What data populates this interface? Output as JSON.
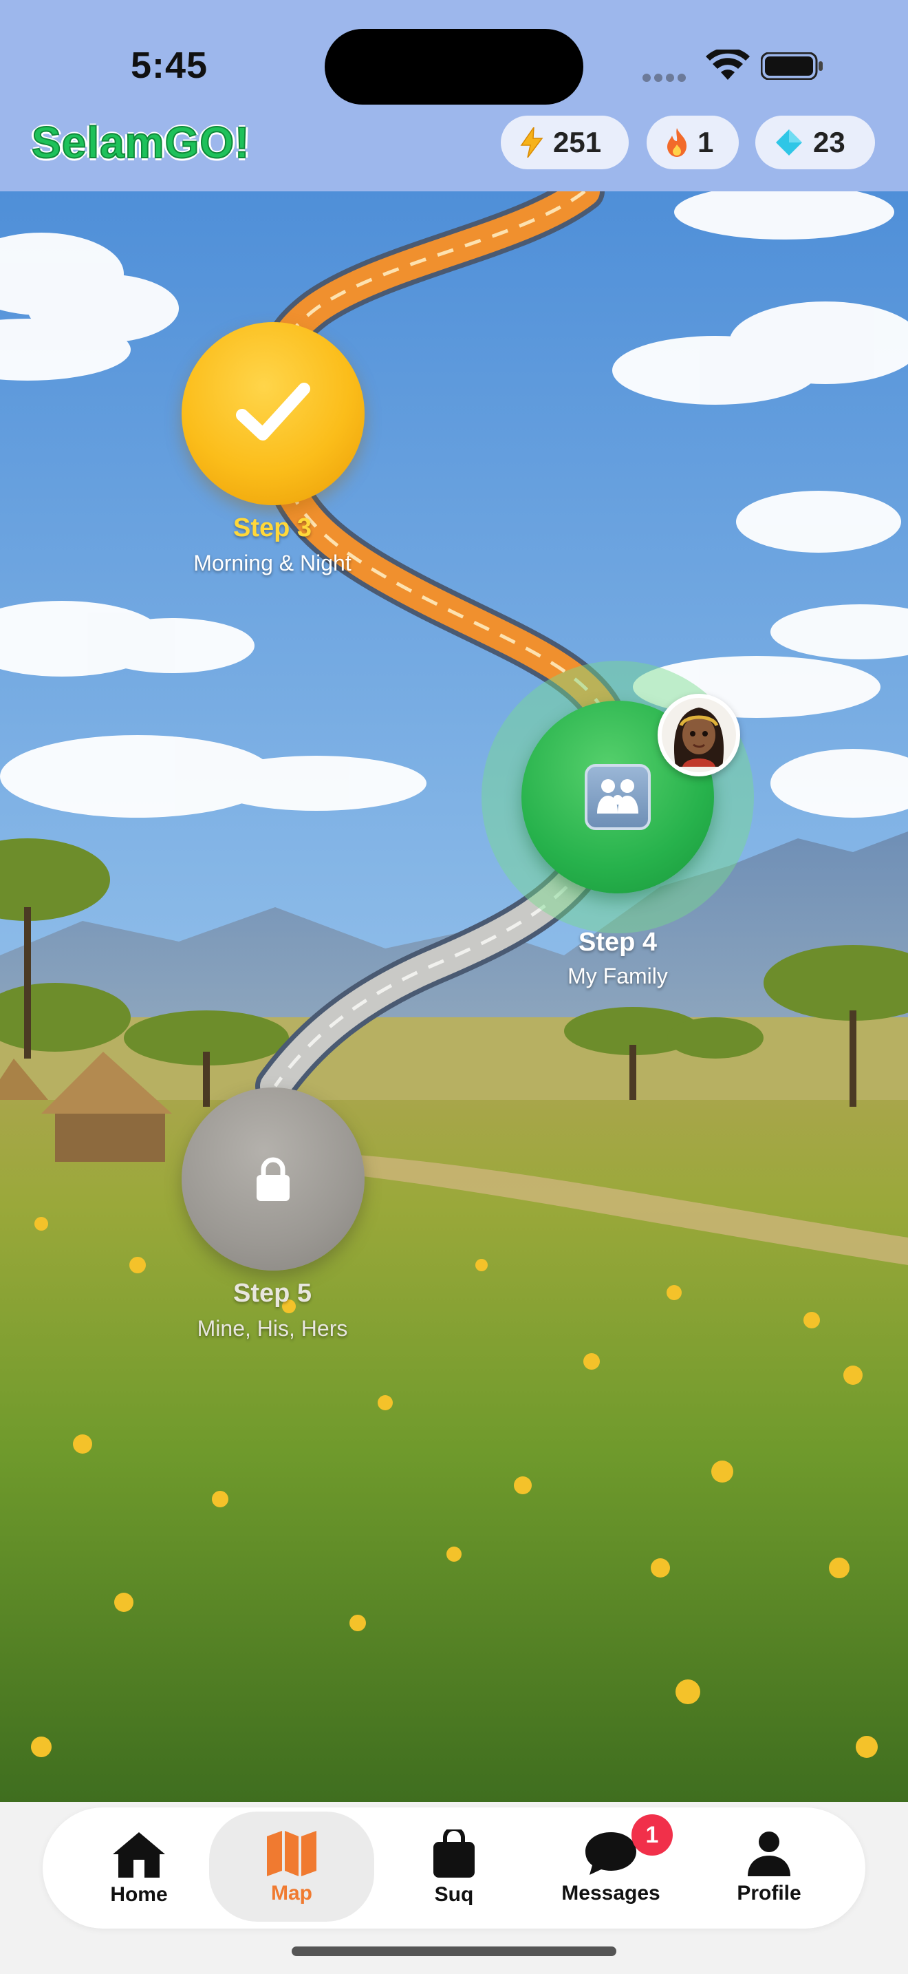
{
  "status_bar": {
    "time": "5:45"
  },
  "header": {
    "brand": "SelamGO!",
    "stats": [
      {
        "name": "energy",
        "icon": "lightning-icon",
        "value": "251"
      },
      {
        "name": "streak",
        "icon": "flame-icon",
        "value": "1"
      },
      {
        "name": "gems",
        "icon": "diamond-icon",
        "value": "23"
      }
    ]
  },
  "map": {
    "steps": [
      {
        "title": "Step 3",
        "subtitle": "Morning & Night",
        "state": "completed",
        "icon": "checkmark-icon"
      },
      {
        "title": "Step 4",
        "subtitle": "My Family",
        "state": "current",
        "icon": "family-icon"
      },
      {
        "title": "Step 5",
        "subtitle": "Mine, His, Hers",
        "state": "locked",
        "icon": "lock-icon"
      }
    ]
  },
  "tabbar": {
    "tabs": [
      {
        "label": "Home",
        "icon": "home-icon"
      },
      {
        "label": "Map",
        "icon": "map-icon",
        "active": true
      },
      {
        "label": "Suq",
        "icon": "shopping-bag-icon"
      },
      {
        "label": "Messages",
        "icon": "chat-bubble-icon",
        "badge": "1"
      },
      {
        "label": "Profile",
        "icon": "person-icon"
      }
    ]
  },
  "colors": {
    "brand": "#1ec15a",
    "active_tab": "#f07a30",
    "badge": "#f1304a",
    "header_bg": "#9db7ec"
  }
}
